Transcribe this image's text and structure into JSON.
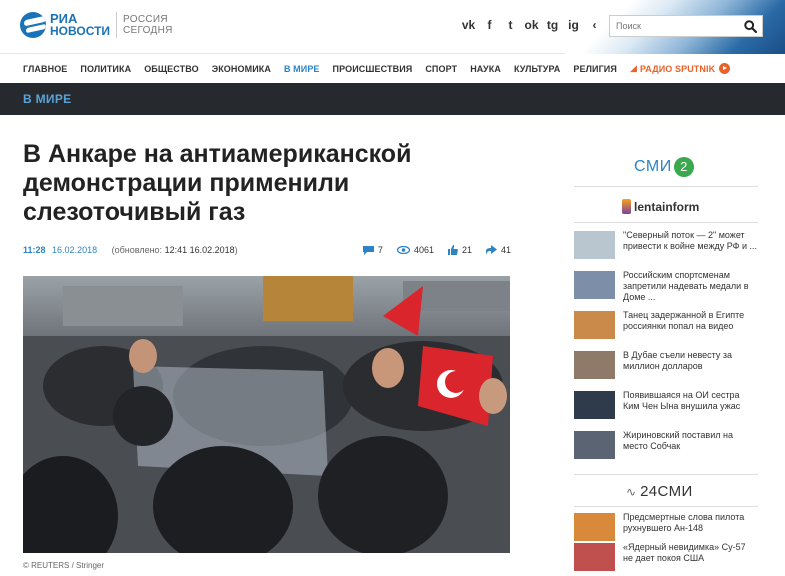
{
  "header": {
    "logo_ria": "РИА",
    "logo_news": "НОВОСТИ",
    "logo_rs_line1": "РОССИЯ",
    "logo_rs_line2": "СЕГОДНЯ",
    "social": [
      "vk-icon",
      "facebook-icon",
      "twitter-icon",
      "odnoklassniki-icon",
      "telegram-icon",
      "instagram-icon",
      "share-icon"
    ],
    "social_glyphs": [
      "vk",
      "f",
      "t",
      "ok",
      "tg",
      "ig",
      "‹"
    ],
    "search_placeholder": "Поиск"
  },
  "nav": {
    "items": [
      "ГЛАВНОЕ",
      "ПОЛИТИКА",
      "ОБЩЕСТВО",
      "ЭКОНОМИКА",
      "В МИРЕ",
      "ПРОИСШЕСТВИЯ",
      "СПОРТ",
      "НАУКА",
      "КУЛЬТУРА",
      "РЕЛИГИЯ"
    ],
    "active": "В МИРЕ",
    "radio": "РАДИО SPUTNIK",
    "radio_color": "#e8622a"
  },
  "section": {
    "title": "В МИРЕ"
  },
  "article": {
    "headline": "В Анкаре на антиамериканской демонстрации применили слезоточивый газ",
    "time": "11:28",
    "date": "16.02.2018",
    "updated_prefix": "(обновлено: ",
    "updated_value": "12:41 16.02.2018",
    "updated_suffix": ")",
    "stats": {
      "comments": "7",
      "views": "4061",
      "likes": "21",
      "shares": "41"
    },
    "photo_caption": "© REUTERS / Stringer"
  },
  "sidebar": {
    "smi2_label": "СМИ",
    "smi2_badge": "2",
    "lentainform_label": "lentainform",
    "news": [
      {
        "text": "\"Северный поток — 2\" может привести к войне между РФ и ...",
        "thumb": "#b9c6cf"
      },
      {
        "text": "Российским спортсменам запретили надевать медали в Доме ...",
        "thumb": "#7c8ea8"
      },
      {
        "text": "Танец задержанной в Египте россиянки попал на видео",
        "thumb": "#c98a4a"
      },
      {
        "text": "В Дубае съели невесту за миллион долларов",
        "thumb": "#8f7a6a"
      },
      {
        "text": "Появившаяся на ОИ сестра Ким Чен Ына внушила ужас",
        "thumb": "#2f3a4a"
      },
      {
        "text": "Жириновский поставил на место Собчак",
        "thumb": "#5b6472"
      }
    ],
    "smi24_label": "24СМИ",
    "news24": [
      {
        "text": "Предсмертные слова пилота рухнувшего Ан-148",
        "thumb": "#d88a3a"
      },
      {
        "text": "«Ядерный невидимка» Су-57 не дает покоя США",
        "thumb": "#c0504d"
      }
    ]
  },
  "colors": {
    "accent": "#2d84c4",
    "section_bg": "#262a2e",
    "smi2_badge": "#3aa84c"
  }
}
